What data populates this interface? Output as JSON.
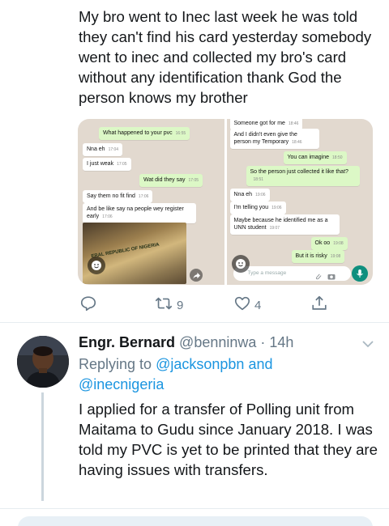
{
  "tweet": {
    "text": "My bro went to Inec last week he was told they can't find his card yesterday somebody went to inec and collected my bro's card without any identification thank God the person knows my brother",
    "reply_count": "",
    "retweet_count": "9",
    "like_count": "4"
  },
  "chat_left": {
    "messages": [
      {
        "text": "What happened to your pvc",
        "time": "16:55",
        "dir": "out"
      },
      {
        "text": "Nna eh",
        "time": "17:04",
        "dir": "in"
      },
      {
        "text": "I just weak",
        "time": "17:05",
        "dir": "in"
      },
      {
        "text": "Wat did they say",
        "time": "17:05",
        "dir": "out"
      },
      {
        "text": "Say them no fit find",
        "time": "17:06",
        "dir": "in"
      },
      {
        "text": "And be like say na people wey register early",
        "time": "17:06",
        "dir": "in"
      }
    ],
    "card_text": "ERAL REPUBLIC OF NIGERIA"
  },
  "chat_right": {
    "messages": [
      {
        "text": "Someone got for me",
        "time": "18:46",
        "dir": "in"
      },
      {
        "text": "And I didn't even give the person my Temporary",
        "time": "18:46",
        "dir": "in"
      },
      {
        "text": "You can imagine",
        "time": "18:50",
        "dir": "out"
      },
      {
        "text": "So the person just collected it like that?",
        "time": "18:51",
        "dir": "out"
      },
      {
        "text": "Nna eh",
        "time": "19:06",
        "dir": "in"
      },
      {
        "text": "I'm telling you",
        "time": "19:06",
        "dir": "in"
      },
      {
        "text": "Maybe because he identified me as a UNN student",
        "time": "19:07",
        "dir": "in"
      },
      {
        "text": "Ok oo",
        "time": "19:08",
        "dir": "out"
      },
      {
        "text": "But it is risky",
        "time": "19:08",
        "dir": "out"
      }
    ],
    "compose_placeholder": "Type a message"
  },
  "reply": {
    "name": "Engr. Bernard",
    "handle": "@benninwa",
    "time": "· 14h",
    "replying_prefix": "Replying to",
    "mention_1": "@jacksonpbn",
    "and_word": "and",
    "mention_2": "@inecnigeria",
    "text": "I applied for a transfer of Polling unit from Maitama to Gudu since January 2018. I was told my PVC is yet to be printed that they are having issues with transfers."
  },
  "colors": {
    "accent": "#1b95e0",
    "muted": "#657786",
    "wa_out": "#dcf8c6",
    "wa_bg": "#e2d9cf"
  },
  "icons": [
    "reply-icon",
    "retweet-icon",
    "like-icon",
    "share-icon",
    "chevron-down-icon"
  ]
}
